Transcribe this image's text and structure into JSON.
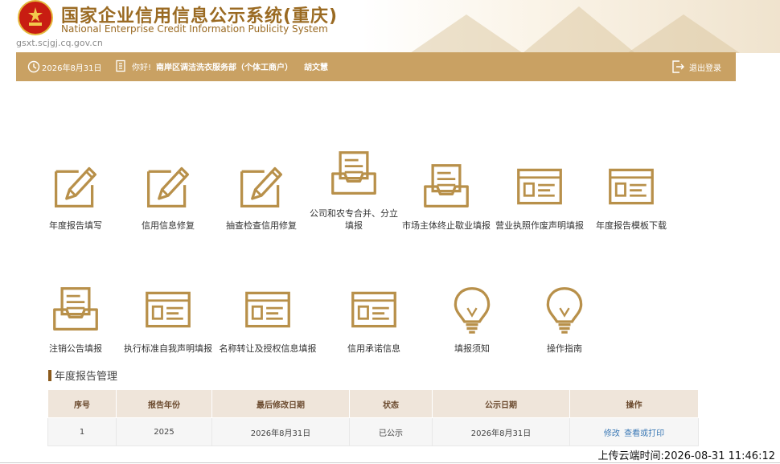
{
  "header": {
    "title_cn": "国家企业信用信息公示系统(重庆)",
    "title_en": "National Enterprise Credit Information Publicity System",
    "domain": "gsxt.scjgj.cq.gov.cn"
  },
  "navbar": {
    "date": "2026年8月31日",
    "greeting": "你好!",
    "company": "南岸区调洁洗衣服务部（个体工商户）",
    "user": "胡文慧",
    "logout": "退出登录"
  },
  "functions": [
    {
      "label": "年度报告填写",
      "icon": "pencil-form-icon"
    },
    {
      "label": "信用信息修复",
      "icon": "pencil-form-icon"
    },
    {
      "label": "抽查检查信用修复",
      "icon": "pencil-form-icon"
    },
    {
      "label_line1": "公司和农专合并、分立",
      "label_line2": "填报",
      "icon": "inbox-tray-icon"
    },
    {
      "label": "市场主体终止歇业填报",
      "icon": "inbox-tray-icon"
    },
    {
      "label": "营业执照作废声明填报",
      "icon": "document-card-icon"
    },
    {
      "label": "年度报告模板下载",
      "icon": "document-card-icon"
    },
    {
      "label": "注销公告填报",
      "icon": "inbox-tray-icon"
    },
    {
      "label": "执行标准自我声明填报",
      "icon": "document-card-icon"
    },
    {
      "label": "名称转让及授权信息填报",
      "icon": "document-card-icon"
    },
    {
      "label": "信用承诺信息",
      "icon": "document-card-icon"
    },
    {
      "label": "填报须知",
      "icon": "lightbulb-icon"
    },
    {
      "label": "操作指南",
      "icon": "lightbulb-icon"
    }
  ],
  "report_section": {
    "title": "年度报告管理",
    "columns": [
      "序号",
      "报告年份",
      "最后修改日期",
      "状态",
      "公示日期",
      "操作"
    ],
    "rows": [
      {
        "no": "1",
        "year": "2025",
        "modified": "2026年8月31日",
        "status": "已公示",
        "published": "2026年8月31日",
        "action_edit": "修改",
        "action_view": "查看或打印"
      }
    ]
  },
  "footer": {
    "upload_time": "上传云端时间:2026-08-31 11:46:12"
  },
  "colors": {
    "gold": "#c9a163",
    "icon_gold": "#b8904a",
    "header_text": "#9a6a22",
    "link": "#3a78b5"
  }
}
